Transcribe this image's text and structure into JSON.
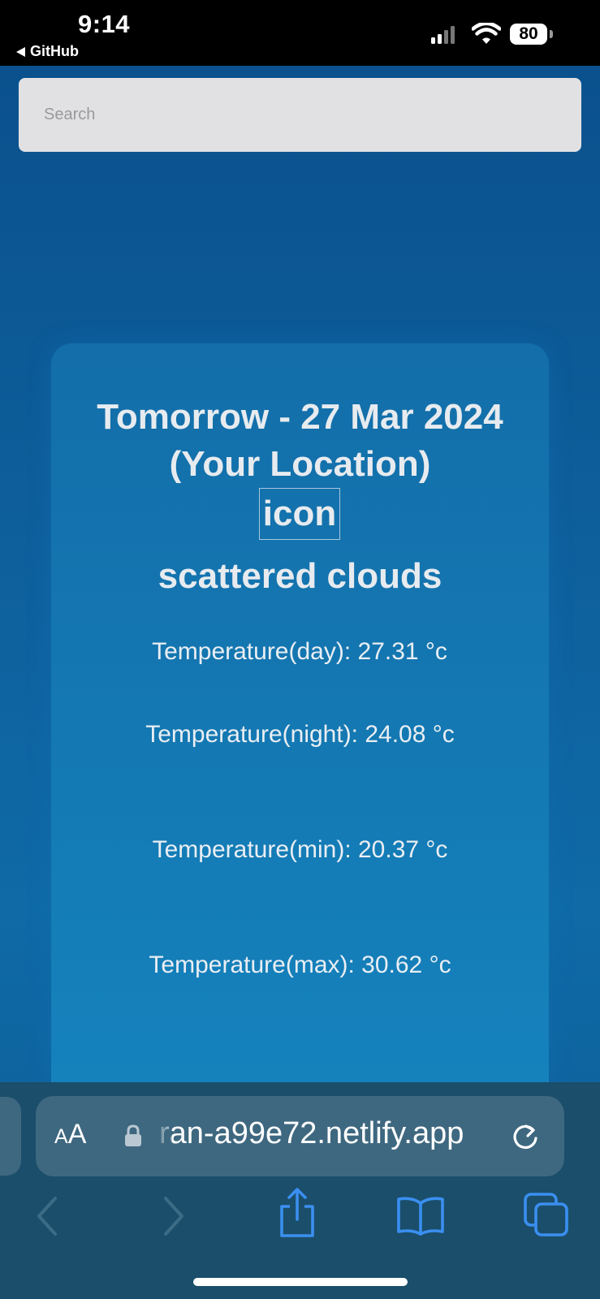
{
  "status_bar": {
    "time": "9:14",
    "back_app": "GitHub",
    "battery": "80"
  },
  "search": {
    "placeholder": "Search",
    "value": ""
  },
  "weather_card": {
    "title": "Tomorrow - 27 Mar 2024 (Your Location)",
    "icon_alt": "icon",
    "description": "scattered clouds",
    "temperature_day": "Temperature(day): 27.31 °c",
    "temperature_night": "Temperature(night): 24.08 °c",
    "temperature_min": "Temperature(min): 20.37 °c",
    "temperature_max": "Temperature(max): 30.62 °c"
  },
  "browser": {
    "reader_button": "AA",
    "url": "ran-a99e72.netlify.app",
    "icons": [
      "back-chevron",
      "forward-chevron",
      "share",
      "bookmarks",
      "tabs",
      "reload",
      "lock"
    ]
  },
  "colors": {
    "accent": "#3a8ff0",
    "page_background": "#0d5f9b",
    "card_background": "#1479b3",
    "toolbar_background": "#1b4e6b"
  }
}
